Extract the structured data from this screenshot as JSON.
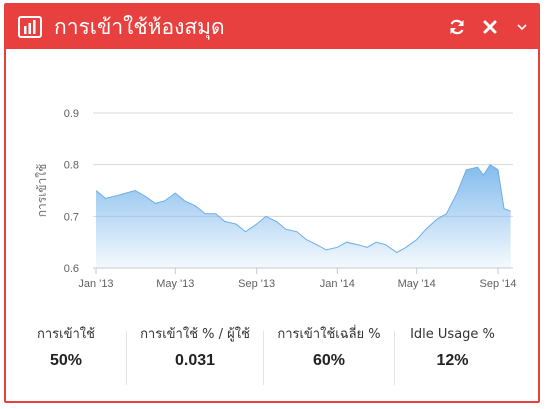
{
  "header": {
    "title": "การเข้าใช้ห้องสมุด",
    "icons": [
      "bar-chart-icon",
      "refresh-icon",
      "close-icon",
      "chevron-down-icon"
    ],
    "color": "#e8403f"
  },
  "chart_data": {
    "type": "area",
    "title": "",
    "xlabel": "",
    "ylabel": "การเข้าใช้",
    "ylim": [
      0.6,
      0.9
    ],
    "yticks": [
      "0.6",
      "0.7",
      "0.8",
      "0.9"
    ],
    "xticks": [
      "Jan '13",
      "May '13",
      "Sep '13",
      "Jan '14",
      "May '14",
      "Sep '14"
    ],
    "grid": true,
    "series": [
      {
        "color": "#6aaee8",
        "x": [
          "2013-01-01",
          "2013-01-15",
          "2013-02-01",
          "2013-02-15",
          "2013-03-01",
          "2013-03-15",
          "2013-04-01",
          "2013-04-15",
          "2013-05-01",
          "2013-05-15",
          "2013-06-01",
          "2013-06-15",
          "2013-07-01",
          "2013-07-15",
          "2013-08-01",
          "2013-08-15",
          "2013-09-01",
          "2013-09-15",
          "2013-10-01",
          "2013-10-15",
          "2013-11-01",
          "2013-11-15",
          "2013-12-01",
          "2013-12-15",
          "2014-01-01",
          "2014-01-15",
          "2014-02-01",
          "2014-02-15",
          "2014-03-01",
          "2014-03-15",
          "2014-04-01",
          "2014-04-15",
          "2014-05-01",
          "2014-05-15",
          "2014-06-01",
          "2014-06-15",
          "2014-07-01",
          "2014-07-15",
          "2014-08-01",
          "2014-08-10",
          "2014-08-20",
          "2014-09-01",
          "2014-09-10",
          "2014-09-20"
        ],
        "values": [
          0.75,
          0.735,
          0.74,
          0.745,
          0.75,
          0.74,
          0.725,
          0.73,
          0.745,
          0.73,
          0.72,
          0.705,
          0.705,
          0.69,
          0.685,
          0.67,
          0.685,
          0.7,
          0.69,
          0.675,
          0.67,
          0.655,
          0.645,
          0.635,
          0.64,
          0.65,
          0.645,
          0.64,
          0.65,
          0.645,
          0.63,
          0.64,
          0.655,
          0.675,
          0.695,
          0.705,
          0.745,
          0.79,
          0.795,
          0.78,
          0.8,
          0.79,
          0.715,
          0.71
        ]
      }
    ]
  },
  "stats": [
    {
      "label": "การเข้าใช้",
      "value": "50%"
    },
    {
      "label": "การเข้าใช้ % / ผู้ใช้",
      "value": "0.031"
    },
    {
      "label": "การเข้าใช้เฉลี่ย %",
      "value": "60%"
    },
    {
      "label": "Idle Usage %",
      "value": "12%"
    }
  ]
}
